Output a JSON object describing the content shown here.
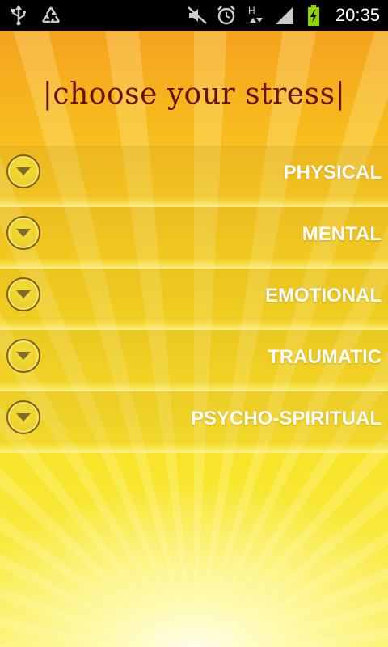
{
  "status_bar": {
    "time": "20:35",
    "left_icons": [
      "usb-icon",
      "recycle-icon"
    ],
    "right_icons": [
      "mute-icon",
      "alarm-icon",
      "hplus-data-icon",
      "signal-icon",
      "battery-charging-icon"
    ]
  },
  "title": "|choose your stress|",
  "stress_items": [
    {
      "label": "PHYSICAL"
    },
    {
      "label": "MENTAL"
    },
    {
      "label": "EMOTIONAL"
    },
    {
      "label": "TRAUMATIC"
    },
    {
      "label": "PSYCHO-SPIRITUAL"
    }
  ],
  "colors": {
    "title": "#6b0f0a",
    "label": "#ffffff",
    "background_top": "#f5a21f",
    "background_bottom": "#fbef5a"
  }
}
